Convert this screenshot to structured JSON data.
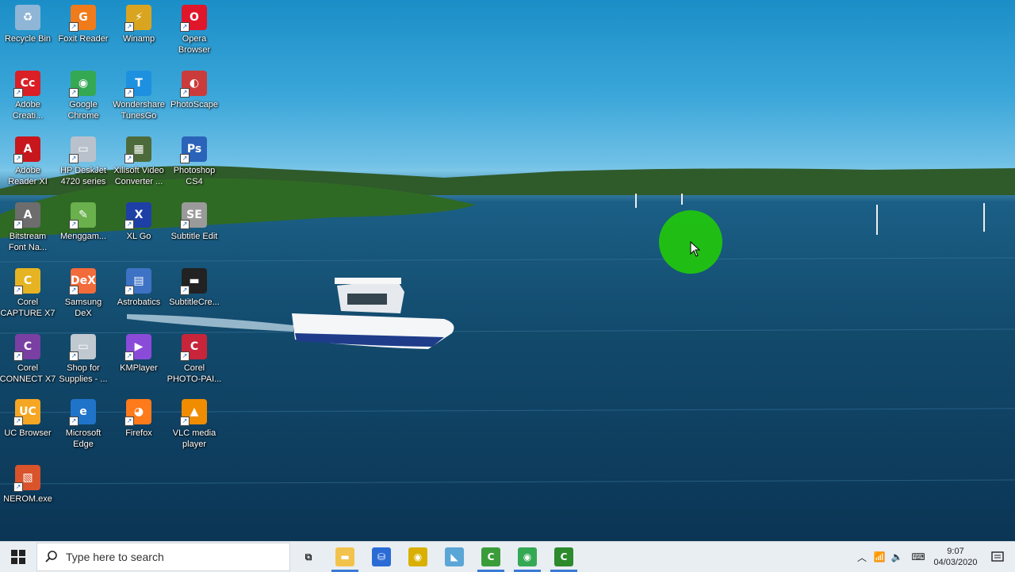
{
  "desktop": {
    "icons": [
      {
        "label": "Recycle Bin",
        "icon": "recycle-bin-icon",
        "color": "#8fb6d6",
        "glyph": "♻"
      },
      {
        "label": "Foxit Reader",
        "icon": "foxit-reader-icon",
        "color": "#f07b1b",
        "glyph": "G"
      },
      {
        "label": "Winamp",
        "icon": "winamp-icon",
        "color": "#d9a520",
        "glyph": "⚡"
      },
      {
        "label": "Opera\nBrowser",
        "icon": "opera-browser-icon",
        "color": "#e0162b",
        "glyph": "O"
      },
      {
        "label": "Adobe\nCreati...",
        "icon": "adobe-creative-cloud-icon",
        "color": "#da1f26",
        "glyph": "Cc"
      },
      {
        "label": "Google\nChrome",
        "icon": "google-chrome-icon",
        "color": "#34a853",
        "glyph": "◉"
      },
      {
        "label": "Wondershare\nTunesGo",
        "icon": "wondershare-tunesgo-icon",
        "color": "#1e90e0",
        "glyph": "T"
      },
      {
        "label": "PhotoScape",
        "icon": "photoscape-icon",
        "color": "#cc3b3b",
        "glyph": "◐"
      },
      {
        "label": "Adobe\nReader XI",
        "icon": "adobe-reader-icon",
        "color": "#c8161d",
        "glyph": "A"
      },
      {
        "label": "HP DeskJet\n4720 series",
        "icon": "hp-printer-icon",
        "color": "#b9c2cc",
        "glyph": "▭"
      },
      {
        "label": "Xilisoft Video\nConverter ...",
        "icon": "xilisoft-video-converter-icon",
        "color": "#4d6b3a",
        "glyph": "▦"
      },
      {
        "label": "Photoshop\nCS4",
        "icon": "photoshop-icon",
        "color": "#2a63b8",
        "glyph": "Ps"
      },
      {
        "label": "Bitstream\nFont Na...",
        "icon": "bitstream-font-icon",
        "color": "#6d6d6d",
        "glyph": "A"
      },
      {
        "label": "Menggam...",
        "icon": "menggambar-icon",
        "color": "#6ab04c",
        "glyph": "✎"
      },
      {
        "label": "XL Go",
        "icon": "xl-go-icon",
        "color": "#1d3fa6",
        "glyph": "X"
      },
      {
        "label": "Subtitle Edit",
        "icon": "subtitle-edit-icon",
        "color": "#9a9a9a",
        "glyph": "SE"
      },
      {
        "label": "Corel\nCAPTURE X7",
        "icon": "corel-capture-icon",
        "color": "#e6b422",
        "glyph": "C"
      },
      {
        "label": "Samsung\nDeX",
        "icon": "samsung-dex-icon",
        "color": "#f26b3a",
        "glyph": "DeX"
      },
      {
        "label": "Astrobatics",
        "icon": "astrobatics-icon",
        "color": "#3e72c4",
        "glyph": "▤"
      },
      {
        "label": "SubtitleCre...",
        "icon": "subtitle-creator-icon",
        "color": "#222",
        "glyph": "▬"
      },
      {
        "label": "Corel\nCONNECT X7",
        "icon": "corel-connect-icon",
        "color": "#7a3fa3",
        "glyph": "C"
      },
      {
        "label": "Shop for\nSupplies - ...",
        "icon": "shop-for-supplies-icon",
        "color": "#c0c8d0",
        "glyph": "▭"
      },
      {
        "label": "KMPlayer",
        "icon": "kmplayer-icon",
        "color": "#8a4bd9",
        "glyph": "▶"
      },
      {
        "label": "Corel\nPHOTO-PAI...",
        "icon": "corel-photo-paint-icon",
        "color": "#c8253a",
        "glyph": "C"
      },
      {
        "label": "UC Browser",
        "icon": "uc-browser-icon",
        "color": "#f5a623",
        "glyph": "UC"
      },
      {
        "label": "Microsoft\nEdge",
        "icon": "microsoft-edge-icon",
        "color": "#1f74c9",
        "glyph": "e"
      },
      {
        "label": "Firefox",
        "icon": "firefox-icon",
        "color": "#ff7a1a",
        "glyph": "◕"
      },
      {
        "label": "VLC media\nplayer",
        "icon": "vlc-icon",
        "color": "#f08c00",
        "glyph": "▲"
      },
      {
        "label": "NEROM.exe",
        "icon": "nerom-icon",
        "color": "#d9532b",
        "glyph": "▧"
      }
    ]
  },
  "taskbar": {
    "search_placeholder": "Type here to search",
    "pinned": [
      {
        "icon": "task-view-icon",
        "glyph": "⧉",
        "color": "transparent"
      },
      {
        "icon": "file-explorer-icon",
        "glyph": "▬",
        "color": "#f2c34c"
      },
      {
        "icon": "microsoft-store-icon",
        "glyph": "⛁",
        "color": "#2b6bd6"
      },
      {
        "icon": "media-player-icon",
        "glyph": "◉",
        "color": "#d9b000"
      },
      {
        "icon": "app-window-icon",
        "glyph": "◣",
        "color": "#5aa6d6"
      },
      {
        "icon": "camtasia-icon",
        "glyph": "C",
        "color": "#3a9d3a"
      },
      {
        "icon": "google-chrome-icon",
        "glyph": "◉",
        "color": "#34a853"
      },
      {
        "icon": "camtasia-recorder-icon",
        "glyph": "C",
        "color": "#2d8a2d"
      }
    ],
    "clock": {
      "time": "9:07",
      "date": "04/03/2020"
    }
  }
}
